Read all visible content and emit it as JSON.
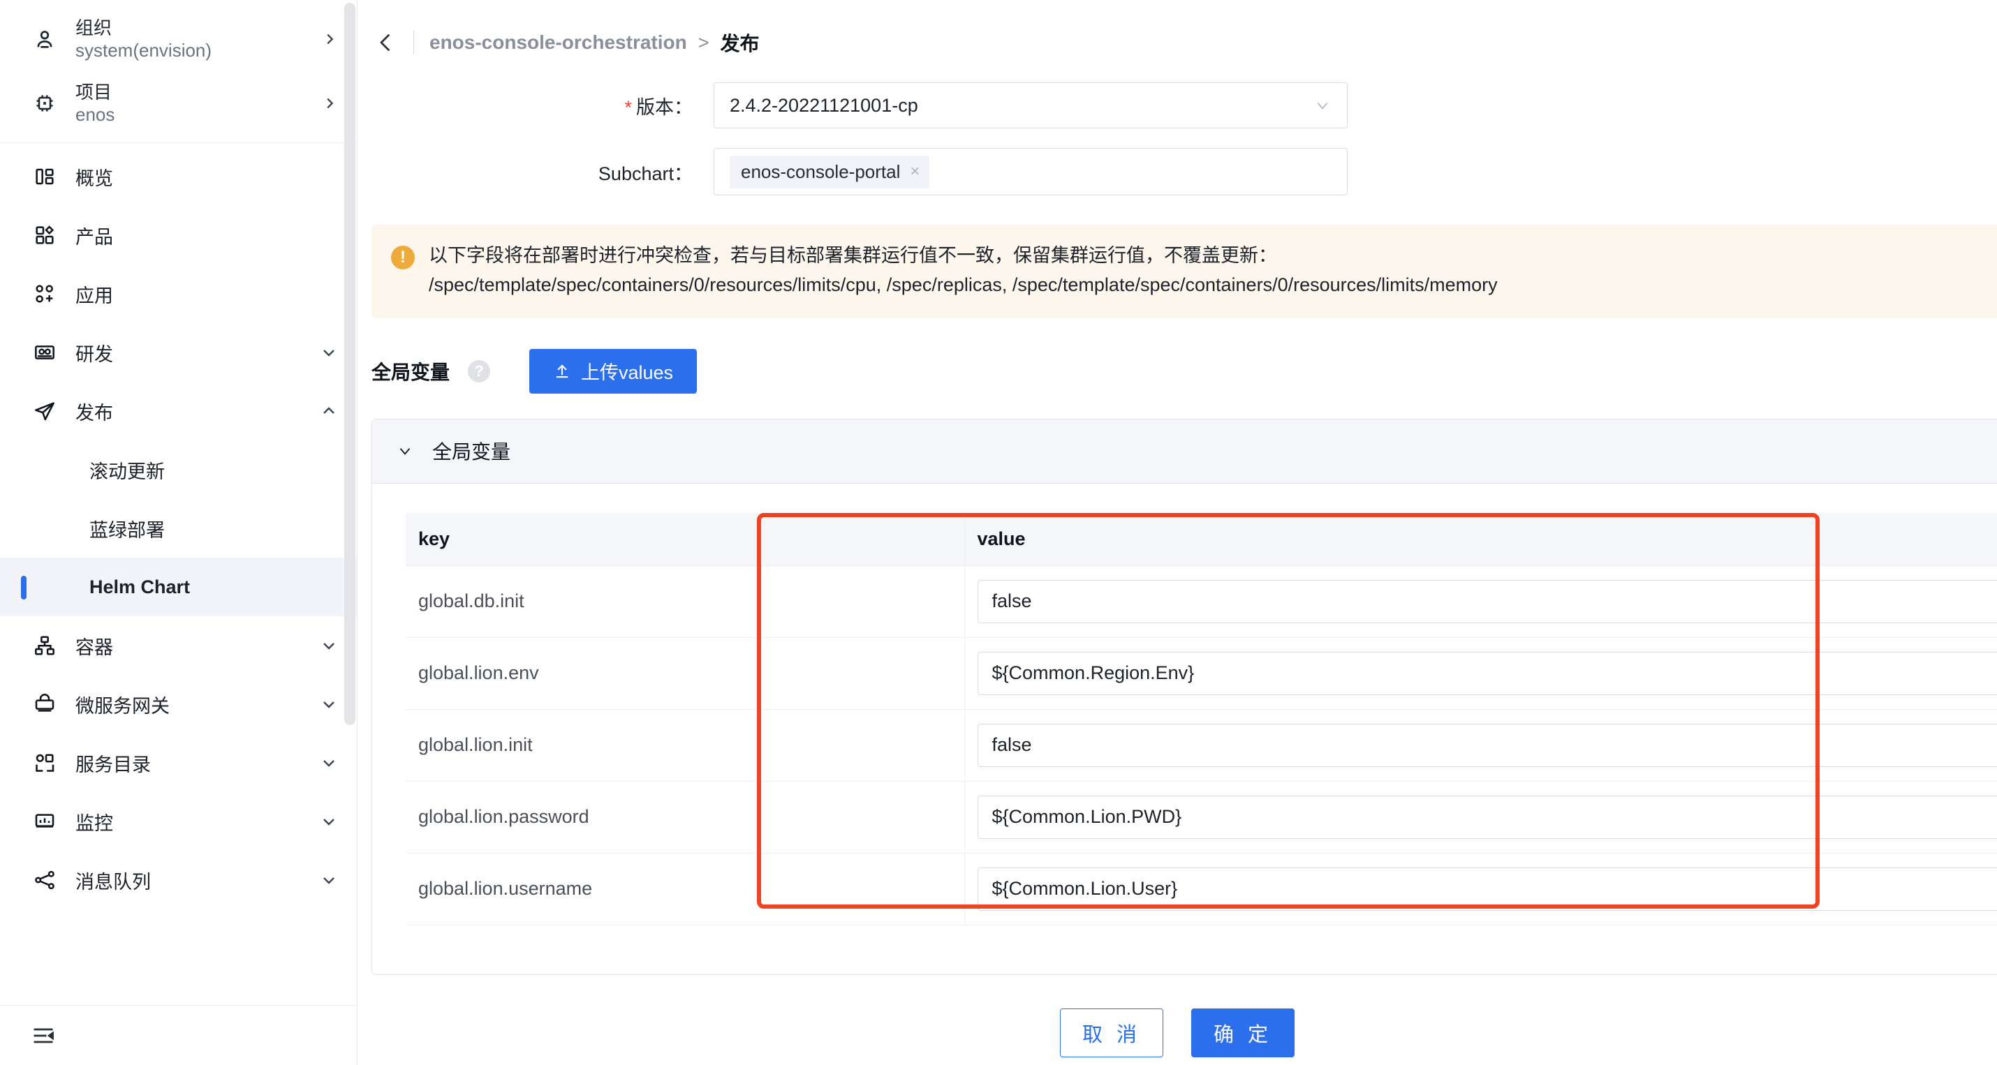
{
  "sidebar": {
    "context": [
      {
        "icon": "user-icon",
        "title": "组织",
        "sub": "system(envision)",
        "arrow": "chevron-right-icon"
      },
      {
        "icon": "chip-icon",
        "title": "项目",
        "sub": "enos",
        "arrow": "chevron-right-icon"
      }
    ],
    "nav": [
      {
        "icon": "overview-icon",
        "label": "概览",
        "chev": ""
      },
      {
        "icon": "product-icon",
        "label": "产品",
        "chev": ""
      },
      {
        "icon": "application-icon",
        "label": "应用",
        "chev": ""
      },
      {
        "icon": "devops-icon",
        "label": "研发",
        "chev": "chevron-down-icon"
      },
      {
        "icon": "publish-icon",
        "label": "发布",
        "chev": "chevron-up-icon"
      }
    ],
    "publish_children": [
      {
        "label": "滚动更新",
        "active": false
      },
      {
        "label": "蓝绿部署",
        "active": false
      },
      {
        "label": "Helm Chart",
        "active": true
      }
    ],
    "nav_rest": [
      {
        "icon": "container-icon",
        "label": "容器",
        "chev": "chevron-down-icon"
      },
      {
        "icon": "gateway-icon",
        "label": "微服务网关",
        "chev": "chevron-down-icon"
      },
      {
        "icon": "catalog-icon",
        "label": "服务目录",
        "chev": "chevron-down-icon"
      },
      {
        "icon": "monitor-icon",
        "label": "监控",
        "chev": "chevron-down-icon"
      },
      {
        "icon": "mq-icon",
        "label": "消息队列",
        "chev": "chevron-down-icon"
      }
    ],
    "footer": {
      "icon": "collapse-sidebar-icon"
    }
  },
  "breadcrumb": {
    "back": "back-arrow-icon",
    "parent": "enos-console-orchestration",
    "separator": ">",
    "current": "发布"
  },
  "form": {
    "version": {
      "label": "版本：",
      "required": true,
      "value": "2.4.2-20221121001-cp",
      "caret": "chevron-down-icon"
    },
    "subchart": {
      "label": "Subchart：",
      "tag": "enos-console-portal",
      "tag_close": "×"
    }
  },
  "warning": {
    "icon": "exclamation-icon",
    "line1": "以下字段将在部署时进行冲突检查，若与目标部署集群运行值不一致，保留集群运行值，不覆盖更新：",
    "line2": "/spec/template/spec/containers/0/resources/limits/cpu, /spec/replicas, /spec/template/spec/containers/0/resources/limits/memory"
  },
  "global_vars": {
    "title": "全局变量",
    "help_icon": "question-icon",
    "upload_button": "上传values",
    "upload_icon": "upload-icon",
    "card_title": "全局变量",
    "card_chevron": "chevron-down-icon",
    "columns": [
      "key",
      "value"
    ],
    "rows": [
      {
        "key": "global.db.init",
        "value": "false"
      },
      {
        "key": "global.lion.env",
        "value": "${Common.Region.Env}"
      },
      {
        "key": "global.lion.init",
        "value": "false"
      },
      {
        "key": "global.lion.password",
        "value": "${Common.Lion.PWD}"
      },
      {
        "key": "global.lion.username",
        "value": "${Common.Lion.User}"
      }
    ]
  },
  "footer": {
    "cancel": "取 消",
    "confirm": "确 定"
  },
  "colors": {
    "primary": "#2b6fed",
    "annotation": "#f04323",
    "warning_bg": "#fdf6ec",
    "warning_icon": "#eeab3c",
    "required_star": "#f04134"
  }
}
